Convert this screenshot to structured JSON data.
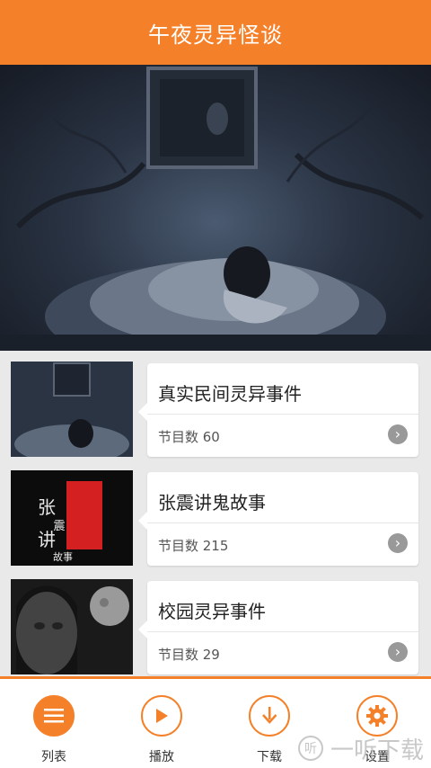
{
  "header": {
    "title": "午夜灵异怪谈"
  },
  "colors": {
    "accent": "#f4812a",
    "arrow": "#999999"
  },
  "programs": [
    {
      "name": "真实民间灵异事件",
      "count": "节目数 60"
    },
    {
      "name": "张震讲鬼故事",
      "count": "节目数 215",
      "thumb_text": "张震讲故事"
    },
    {
      "name": "校园灵异事件",
      "count": "节目数 29"
    }
  ],
  "tabs": [
    {
      "label": "列表",
      "icon": "list-icon"
    },
    {
      "label": "播放",
      "icon": "play-icon"
    },
    {
      "label": "下载",
      "icon": "download-icon"
    },
    {
      "label": "设置",
      "icon": "gear-icon"
    }
  ],
  "watermark": {
    "text": "一听下载",
    "icon_char": "听"
  }
}
